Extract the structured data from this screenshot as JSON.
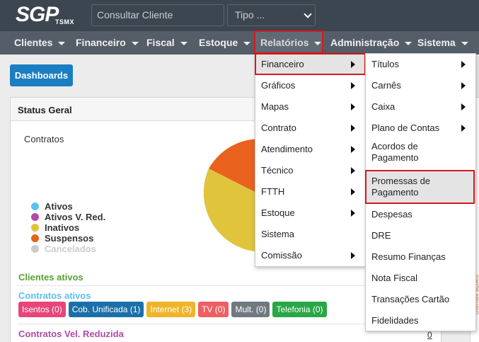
{
  "header": {
    "logo_main": "SGP",
    "logo_sub": "TSMX",
    "search_placeholder": "Consultar Cliente",
    "tipo_label": "Tipo ..."
  },
  "menu": [
    {
      "label": "Clientes"
    },
    {
      "label": "Financeiro"
    },
    {
      "label": "Fiscal"
    },
    {
      "label": "Estoque"
    },
    {
      "label": "Relatórios"
    },
    {
      "label": "Administração"
    },
    {
      "label": "Sistema"
    }
  ],
  "dashboard_button": "Dashboards",
  "panel": {
    "title": "Status Geral",
    "contratos_label": "Contratos"
  },
  "legend": [
    {
      "label": "Ativos",
      "color": "#5bc0f0"
    },
    {
      "label": "Ativos V. Red.",
      "color": "#b04aa6"
    },
    {
      "label": "Inativos",
      "color": "#dfc43c"
    },
    {
      "label": "Suspensos",
      "color": "#e8621e"
    },
    {
      "label": "Cancelados",
      "color": "#cccccc"
    }
  ],
  "sections": {
    "clientes_ativos": "Clientes ativos",
    "contratos_ativos": "Contratos ativos",
    "contratos_vel_reduzida": "Contratos Vel. Reduzida",
    "vel_reduzida_count": "0"
  },
  "badges": [
    {
      "label": "Isentos (0)",
      "color": "#e8457a"
    },
    {
      "label": "Cob. Unificada (1)",
      "color": "#1b6fa8"
    },
    {
      "label": "Internet (3)",
      "color": "#f0b429"
    },
    {
      "label": "TV (0)",
      "color": "#ef5f62"
    },
    {
      "label": "Mult. (0)",
      "color": "#707880"
    },
    {
      "label": "Telefonia (0)",
      "color": "#27a745"
    }
  ],
  "relatorios_menu": [
    {
      "label": "Financeiro",
      "submenu": true
    },
    {
      "label": "Gráficos",
      "submenu": true
    },
    {
      "label": "Mapas",
      "submenu": true
    },
    {
      "label": "Contrato",
      "submenu": true
    },
    {
      "label": "Atendimento",
      "submenu": true
    },
    {
      "label": "Técnico",
      "submenu": true
    },
    {
      "label": "FTTH",
      "submenu": true
    },
    {
      "label": "Estoque",
      "submenu": true
    },
    {
      "label": "Sistema",
      "submenu": false
    },
    {
      "label": "Comissão",
      "submenu": true
    }
  ],
  "financeiro_submenu": [
    {
      "label": "Títulos",
      "submenu": true
    },
    {
      "label": "Carnês",
      "submenu": true
    },
    {
      "label": "Caixa",
      "submenu": true
    },
    {
      "label": "Plano de Contas",
      "submenu": true
    },
    {
      "label": "Acordos de Pagamento",
      "line1": "Acordos de",
      "line2": "Pagamento",
      "submenu": false
    },
    {
      "label": "Promessas de Pagamento",
      "line1": "Promessas de",
      "line2": "Pagamento",
      "submenu": false
    },
    {
      "label": "Despesas",
      "submenu": false
    },
    {
      "label": "DRE",
      "submenu": false
    },
    {
      "label": "Resumo Finanças",
      "submenu": false
    },
    {
      "label": "Nota Fiscal",
      "submenu": false
    },
    {
      "label": "Transações Cartão",
      "submenu": false
    },
    {
      "label": "Fidelidades",
      "submenu": false
    }
  ],
  "right_panel_text": "Ultimas ações"
}
